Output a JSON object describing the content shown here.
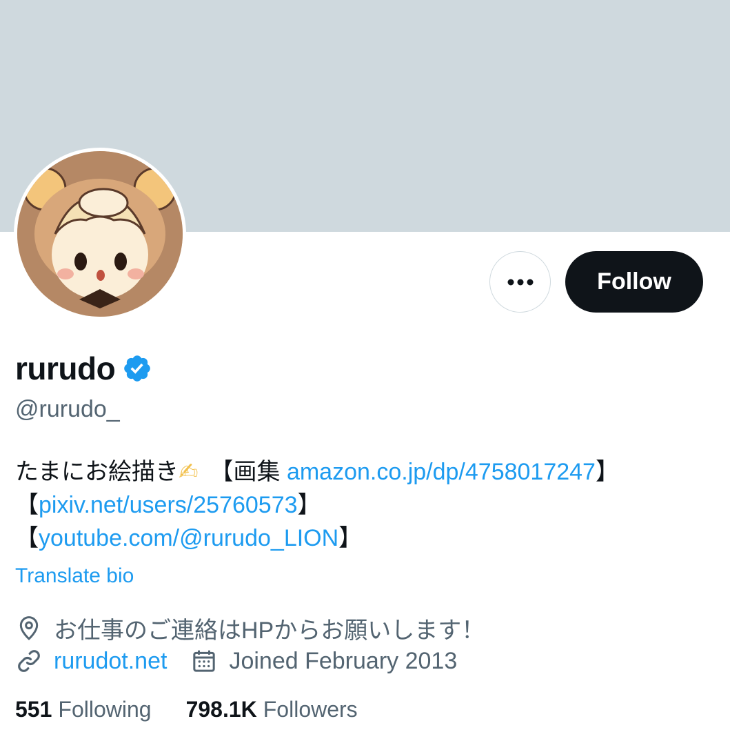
{
  "profile": {
    "display_name": "rurudo",
    "handle": "@rurudo_",
    "verified": true,
    "avatar_icon": "avatar-illustration"
  },
  "actions": {
    "more_icon": "more-horizontal-icon",
    "follow_label": "Follow"
  },
  "bio": {
    "line1_text": "たまにお絵描き",
    "line1_emoji": "✍",
    "line1_bracket_open": "　【画集 ",
    "line1_link": "amazon.co.jp/dp/4758017247",
    "line1_bracket_close": "】",
    "line2_open": "【",
    "line2_link": "pixiv.net/users/25760573",
    "line2_close": "】",
    "line3_open": "【",
    "line3_link": "youtube.com/@rurudo_LION",
    "line3_close": "】"
  },
  "translate_label": "Translate bio",
  "meta": {
    "location": "お仕事のご連絡はHPからお願いします！",
    "website": "rurudot.net",
    "joined": "Joined February 2013"
  },
  "stats": {
    "following_count": "551",
    "following_label": "Following",
    "followers_count": "798.1K",
    "followers_label": "Followers"
  },
  "colors": {
    "banner": "#cfd9de",
    "link": "#1d9bf0",
    "secondary_text": "#536471",
    "follow_button": "#0f1419",
    "verified_badge": "#1d9bf0"
  }
}
